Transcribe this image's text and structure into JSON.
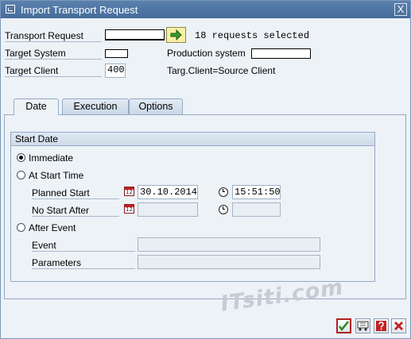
{
  "window": {
    "title": "Import Transport Request",
    "close_glyph": "X"
  },
  "header_fields": {
    "transport_request_label": "Transport Request",
    "transport_request_value": "",
    "selection_info": "18 requests selected",
    "target_system_label": "Target System",
    "target_system_value": "",
    "production_system_label": "Production system",
    "production_system_value": "",
    "target_client_label": "Target Client",
    "target_client_value": "400",
    "client_note": "Targ.Client=Source Client"
  },
  "tabs": [
    {
      "label": "Date",
      "active": true
    },
    {
      "label": "Execution",
      "active": false
    },
    {
      "label": "Options",
      "active": false
    }
  ],
  "start_date_group": {
    "title": "Start Date",
    "immediate_label": "Immediate",
    "at_start_time_label": "At Start Time",
    "planned_start_label": "Planned Start",
    "planned_start_date": "30.10.2014",
    "planned_start_time": "15:51:50",
    "no_start_after_label": "No Start After",
    "no_start_after_date": "",
    "no_start_after_time": "",
    "after_event_label": "After Event",
    "event_label": "Event",
    "event_value": "",
    "parameters_label": "Parameters",
    "parameters_value": "",
    "calendar_icon_text": "12",
    "selected_option": "Immediate"
  },
  "watermark": "ITsiti.com",
  "icons": {
    "title": "window-icon",
    "close": "close-icon",
    "arrow": "arrow-right-icon",
    "calendar": "calendar-icon",
    "clock": "clock-icon",
    "confirm": "checkmark-icon",
    "transport": "truck-icon",
    "help": "help-icon",
    "cancel": "cancel-icon"
  },
  "colors": {
    "title_bar": "#4f76a6",
    "window_bg": "#edf2f7",
    "confirm_green": "#2f8a20",
    "cancel_red": "#c42020",
    "highlight_yellow": "#f7f0a4"
  }
}
